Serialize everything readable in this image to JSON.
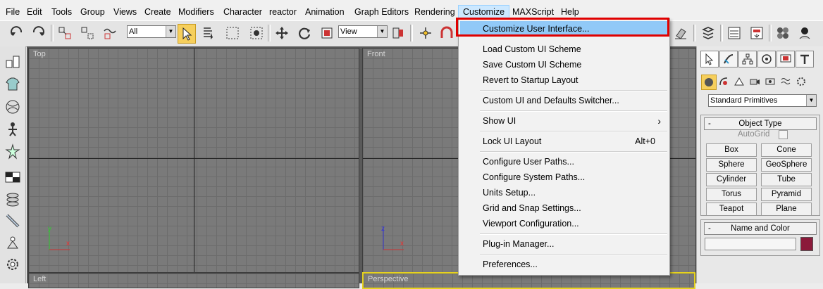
{
  "menubar": {
    "items": [
      "File",
      "Edit",
      "Tools",
      "Group",
      "Views",
      "Create",
      "Modifiers",
      "Character",
      "reactor",
      "Animation",
      "Graph Editors",
      "Rendering",
      "Customize",
      "MAXScript",
      "Help"
    ],
    "active_index": 12
  },
  "toolbar": {
    "selection_filter": "All",
    "reference_coord": "View"
  },
  "viewports": {
    "top": "Top",
    "front": "Front",
    "left": "Left",
    "perspective": "Perspective",
    "axis_x": "x",
    "axis_y": "y",
    "axis_z": "z"
  },
  "command_panel": {
    "category": "Standard Primitives",
    "object_type_title": "Object Type",
    "autogrid": "AutoGrid",
    "buttons": [
      "Box",
      "Cone",
      "Sphere",
      "GeoSphere",
      "Cylinder",
      "Tube",
      "Torus",
      "Pyramid",
      "Teapot",
      "Plane"
    ],
    "name_color_title": "Name and Color",
    "minus": "-",
    "swatch_color": "#8b1a3a"
  },
  "customize_menu": {
    "items": [
      {
        "label": "Customize User Interface...",
        "shortcut": ""
      },
      {
        "label": "Load Custom UI Scheme",
        "shortcut": ""
      },
      {
        "label": "Save Custom UI Scheme",
        "shortcut": ""
      },
      {
        "label": "Revert to Startup Layout",
        "shortcut": ""
      },
      {
        "label": "Custom UI and Defaults Switcher...",
        "shortcut": ""
      },
      {
        "label": "Show UI",
        "shortcut": "›"
      },
      {
        "label": "Lock UI Layout",
        "shortcut": "Alt+0"
      },
      {
        "label": "Configure User Paths...",
        "shortcut": ""
      },
      {
        "label": "Configure System Paths...",
        "shortcut": ""
      },
      {
        "label": "Units Setup...",
        "shortcut": ""
      },
      {
        "label": "Grid and Snap Settings...",
        "shortcut": ""
      },
      {
        "label": "Viewport Configuration...",
        "shortcut": ""
      },
      {
        "label": "Plug-in Manager...",
        "shortcut": ""
      },
      {
        "label": "Preferences...",
        "shortcut": ""
      }
    ]
  },
  "colors": {
    "highlight": "#91c9f7",
    "callout_red": "#e00000",
    "active_viewport": "#e6d21e"
  }
}
